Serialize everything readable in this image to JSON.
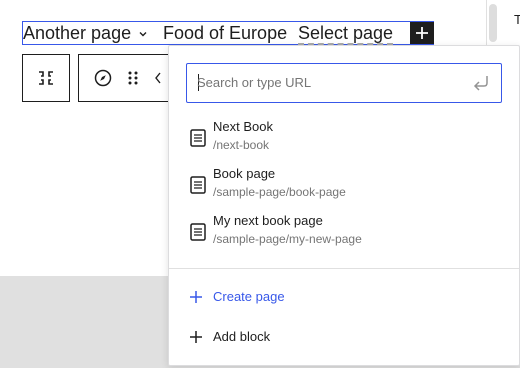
{
  "navigation": {
    "items": [
      {
        "label": "Another page"
      },
      {
        "label": "Food of Europe"
      },
      {
        "label": "Select page"
      }
    ],
    "add_button_icon": "plus-icon"
  },
  "toolbar": {
    "icons": [
      "block-type-icon",
      "compass-icon",
      "drag-handle-icon",
      "chevron-left-icon"
    ]
  },
  "link_control": {
    "search": {
      "placeholder": "Search or type URL",
      "value": ""
    },
    "submit_icon": "enter-return-icon",
    "results": [
      {
        "title": "Next Book",
        "url": "/next-book",
        "icon": "page-icon"
      },
      {
        "title": "Book page",
        "url": "/sample-page/book-page",
        "icon": "page-icon"
      },
      {
        "title": "My next book page",
        "url": "/sample-page/my-new-page",
        "icon": "page-icon"
      }
    ],
    "create_page_label": "Create page",
    "add_block_label": "Add block"
  },
  "right_edge_letter": "T",
  "colors": {
    "accent": "#3858e9",
    "text": "#1e1e1e",
    "muted": "#757575",
    "canvas_bottom": "#e0e0e0"
  }
}
